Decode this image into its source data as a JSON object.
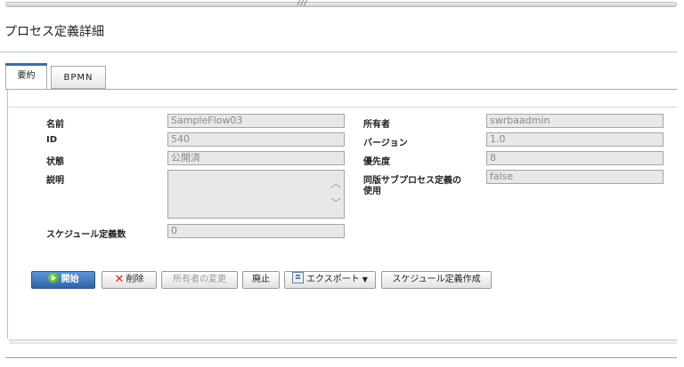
{
  "splitter": {
    "grip": "///"
  },
  "page": {
    "title": "プロセス定義詳細"
  },
  "tabs": [
    {
      "label": "要約",
      "active": true
    },
    {
      "label": "BPMN",
      "active": false
    }
  ],
  "form": {
    "name_label": "名前",
    "name_value": "SampleFlow03",
    "id_label": "ID",
    "id_value": "540",
    "status_label": "状態",
    "status_value": "公開済",
    "description_label": "説明",
    "description_value": "",
    "schedule_count_label": "スケジュール定義数",
    "schedule_count_value": "0",
    "owner_label": "所有者",
    "owner_value": "swrbaadmin",
    "version_label": "バージョン",
    "version_value": "1.0",
    "priority_label": "優先度",
    "priority_value": "8",
    "same_version_label_line1": "同版サブプロセス定義の",
    "same_version_label_line2": "使用",
    "same_version_value": "false"
  },
  "buttons": {
    "start": "開始",
    "delete": "削除",
    "change_owner": "所有者の変更",
    "abolish": "廃止",
    "export": "エクスポート",
    "create_schedule": "スケジュール定義作成"
  },
  "colors": {
    "primary_button": "#3d78c4",
    "active_tab_accent": "#3d6a9e",
    "field_bg": "#e8e8e8",
    "delete_icon": "#d22222"
  },
  "icons": {
    "start": "play-icon",
    "delete": "x-icon",
    "export": "export-icon",
    "dropdown": "caret-down-icon"
  }
}
